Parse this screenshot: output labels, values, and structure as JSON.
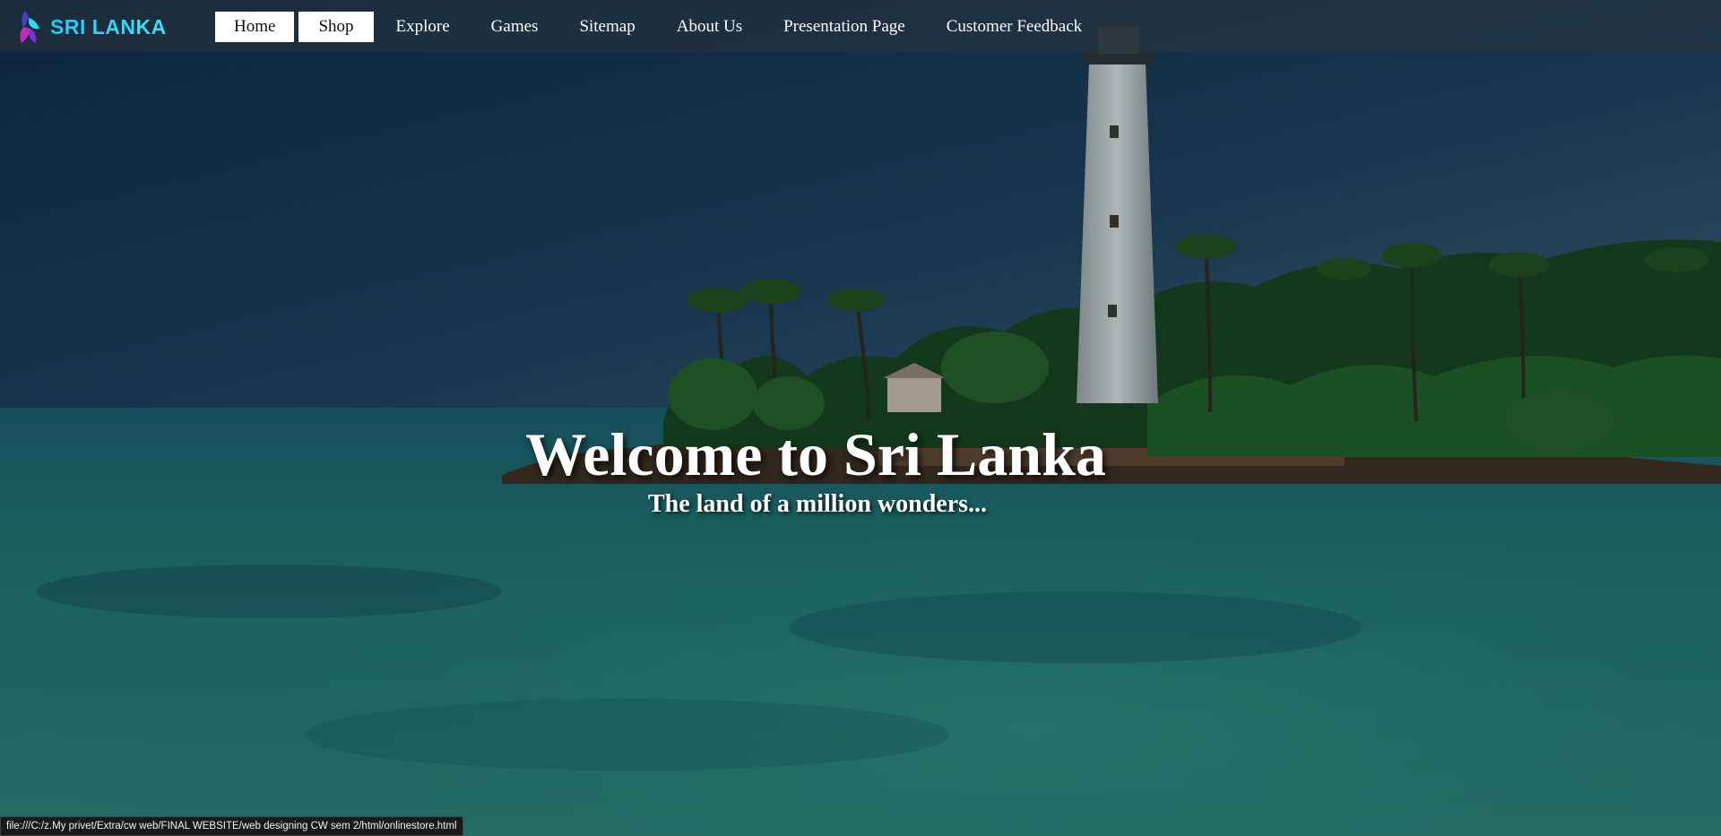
{
  "logo": {
    "text": "SRI LANKA",
    "icon": "butterfly-logo-icon"
  },
  "nav": {
    "items": [
      {
        "label": "Home",
        "style": "boxed"
      },
      {
        "label": "Shop",
        "style": "boxed"
      },
      {
        "label": "Explore"
      },
      {
        "label": "Games"
      },
      {
        "label": "Sitemap"
      },
      {
        "label": "About Us"
      },
      {
        "label": "Presentation Page"
      },
      {
        "label": "Customer Feedback"
      }
    ]
  },
  "hero": {
    "title": "Welcome to Sri Lanka",
    "subtitle": "The land of a million wonders..."
  },
  "status": {
    "url": "file:///C:/z.My privet/Extra/cw web/FINAL WEBSITE/web designing CW sem 2/html/onlinestore.html"
  },
  "colors": {
    "logo_accent": "#27c7ff",
    "nav_bg": "#28343e",
    "sea": "#1f6f6c",
    "sky": "#163550"
  }
}
